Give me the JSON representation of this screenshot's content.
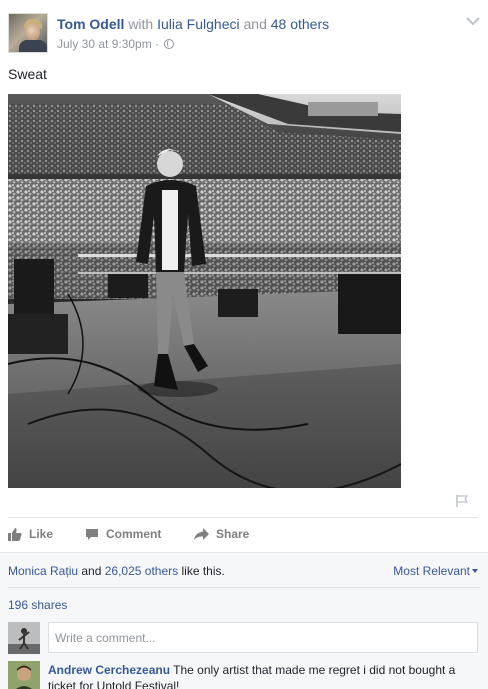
{
  "post": {
    "author": "Tom Odell",
    "with_text": "with",
    "tagged": "Iulia Fulgheci",
    "and_text": "and",
    "others": "48 others",
    "timestamp": "July 30 at 9:30pm",
    "dot": "·",
    "privacy_icon": "globe-icon",
    "text": "Sweat",
    "photo_description_icon": "concert-stage-photo"
  },
  "actions": {
    "like_label": "Like",
    "comment_label": "Comment",
    "share_label": "Share"
  },
  "reactions": {
    "first_name": "Monica Rațiu",
    "and_text": "and",
    "others_link": "26,025 others",
    "suffix": "like this.",
    "sort_label": "Most Relevant"
  },
  "shares": "196 shares",
  "comment_box": {
    "placeholder": "Write a comment..."
  },
  "comments": [
    {
      "author": "Andrew Cerchezeanu",
      "text": "The only artist that made me regret i did not bought a ticket for Untold Festival!"
    }
  ],
  "colors": {
    "link": "#365899",
    "muted": "#90949c",
    "action": "#7f7f7f",
    "comments_bg": "#f6f7f9"
  }
}
